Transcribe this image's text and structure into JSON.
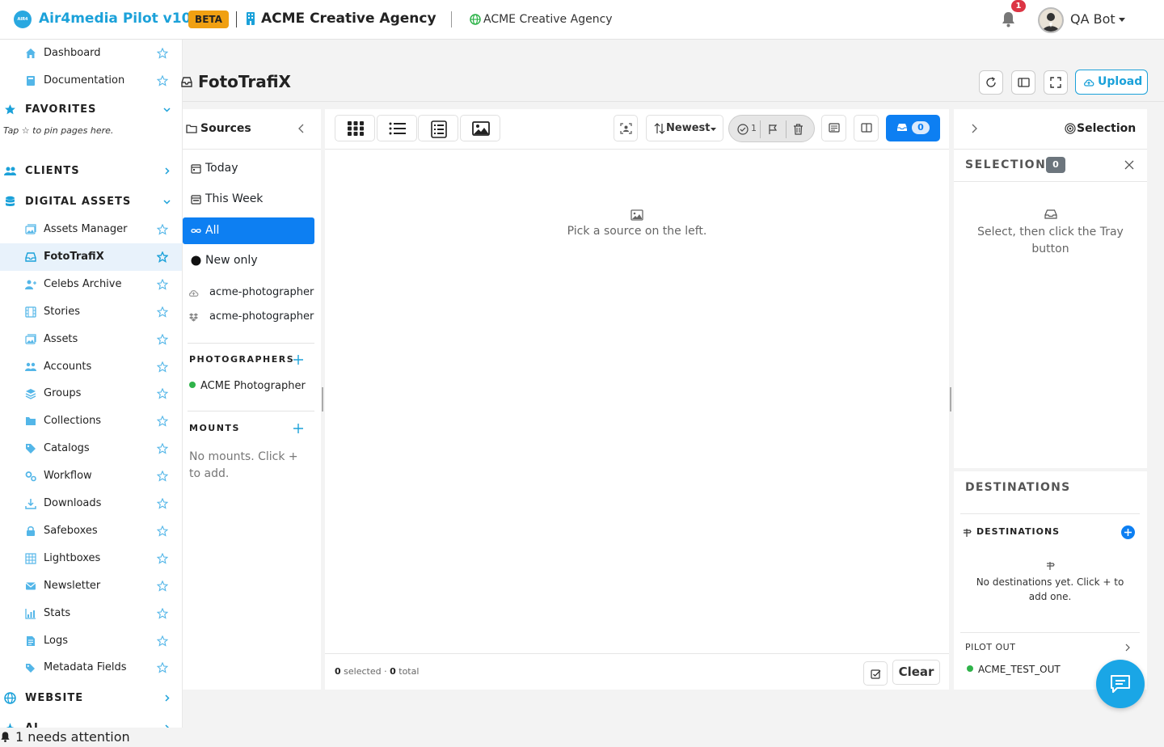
{
  "topbar": {
    "logo_text": "AIR4MEDIA",
    "brand": "Air4media Pilot v10",
    "beta": "BETA",
    "agency": "ACME Creative Agency",
    "agency_link": "ACME Creative Agency",
    "notification_count": "1",
    "user_name": "QA Bot"
  },
  "sidebar": {
    "top_items": [
      {
        "label": "Dashboard",
        "icon": "home-icon"
      },
      {
        "label": "Documentation",
        "icon": "book-icon"
      }
    ],
    "favorites": {
      "label": "FAVORITES",
      "hint": "Tap ☆ to pin pages here."
    },
    "clients": {
      "label": "CLIENTS"
    },
    "digital_assets": {
      "label": "DIGITAL ASSETS",
      "items": [
        {
          "label": "Assets Manager",
          "icon": "images-icon"
        },
        {
          "label": "FotoTrafiX",
          "icon": "inbox-icon",
          "active": true
        },
        {
          "label": "Celebs Archive",
          "icon": "person-icon"
        },
        {
          "label": "Stories",
          "icon": "film-icon"
        },
        {
          "label": "Assets",
          "icon": "images-icon"
        },
        {
          "label": "Accounts",
          "icon": "users-icon"
        },
        {
          "label": "Groups",
          "icon": "layers-icon"
        },
        {
          "label": "Collections",
          "icon": "folder-icon"
        },
        {
          "label": "Catalogs",
          "icon": "tag-icon"
        },
        {
          "label": "Workflow",
          "icon": "gears-icon"
        },
        {
          "label": "Downloads",
          "icon": "download-icon"
        },
        {
          "label": "Safeboxes",
          "icon": "lock-icon"
        },
        {
          "label": "Lightboxes",
          "icon": "grid-icon"
        },
        {
          "label": "Newsletter",
          "icon": "envelope-icon"
        },
        {
          "label": "Stats",
          "icon": "chart-icon"
        },
        {
          "label": "Logs",
          "icon": "file-icon"
        },
        {
          "label": "Metadata Fields",
          "icon": "tags-icon"
        }
      ]
    },
    "website": {
      "label": "WEBSITE"
    },
    "ai": {
      "label": "AI"
    }
  },
  "attention": "1 needs attention",
  "page": {
    "title": "FotoTrafiX",
    "upload_label": "Upload"
  },
  "sources": {
    "title": "Sources",
    "items": [
      {
        "label": "Today"
      },
      {
        "label": "This Week"
      },
      {
        "label": "All",
        "active": true
      },
      {
        "label": "New only"
      }
    ],
    "cloud_items": [
      {
        "label": "acme-photographer",
        "icon": "cloud-upload-icon"
      },
      {
        "label": "acme-photographer",
        "icon": "dropbox-icon"
      }
    ],
    "photographers_title": "PHOTOGRAPHERS",
    "photographer": "ACME Photographer",
    "mounts_title": "MOUNTS",
    "mounts_empty": "No mounts. Click + to add."
  },
  "center": {
    "sort_label": "Newest",
    "filter_count": "1",
    "tray_count": "0",
    "empty_text": "Pick a source on the left.",
    "footer": {
      "selected": "0",
      "selected_label": "selected",
      "separator": "·",
      "total": "0",
      "total_label": "total"
    },
    "clear_label": "Clear"
  },
  "selection": {
    "header": "Selection",
    "title": "SELECTION",
    "count": "0",
    "hint": "Select, then click the Tray button"
  },
  "destinations": {
    "title": "DESTINATIONS",
    "sub_title": "DESTINATIONS",
    "empty": "No destinations yet. Click + to add one.",
    "pilot_out": "PILOT OUT",
    "pilot_item": "ACME_TEST_OUT"
  },
  "colors": {
    "brand": "#1ba1d9",
    "primary": "#0d7ff2",
    "beta": "#f0a012",
    "badge": "#dc3545",
    "online": "#2fb34a"
  }
}
